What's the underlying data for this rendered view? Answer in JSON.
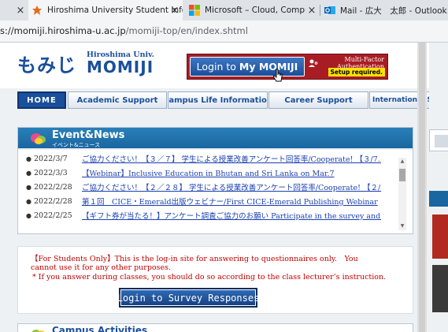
{
  "browser": {
    "tabs": [
      {
        "title": "Hiroshima University Student Infor",
        "close": "×",
        "active": true
      },
      {
        "title": "Microsoft – Cloud, Computers, Ap",
        "close": "×",
        "active": false
      },
      {
        "title": "Mail - 広大　太郎 - Outlook",
        "close": "×",
        "active": false
      }
    ],
    "url_domain": "s://momiji.hiroshima-u.ac.jp",
    "url_path": "/momiji-top/en/index.shtml"
  },
  "header": {
    "logo_jp": "もみじ",
    "logo_univ": "Hiroshima Univ.",
    "logo_name": "MOMIJI",
    "login_prefix": "Login to",
    "login_bold": "My MOMIJI",
    "mfa_line1": "Multi-Factor",
    "mfa_line2": "Authentication",
    "setup": "Setup required."
  },
  "nav": {
    "items": [
      "HOME",
      "Academic Support",
      "Campus Life Information",
      "Career Support",
      "International Student Su"
    ]
  },
  "events": {
    "title": "Event&News",
    "subtitle": "イベント&ニュース",
    "items": [
      {
        "date": "2022/3/7",
        "text": "ご協力ください！【３／７】 学生による授業改善アンケート回答率/Cooperate! 【３/7..."
      },
      {
        "date": "2022/3/3",
        "text": "【Webinar】Inclusive Education in Bhutan and Sri Lanka on Mar.7"
      },
      {
        "date": "2022/2/28",
        "text": "ご協力ください！【２／２８】 学生による授業改善アンケート回答率/Cooperate! 【２/..."
      },
      {
        "date": "2022/2/28",
        "text": "第１回　CICE・Emerald出版ウェビナー/First CICE-Emerald Publishing Webinar"
      },
      {
        "date": "2022/2/25",
        "text": "【ギフト券が当たる！】アンケート調査ご協力のお願い Participate in the survey and..."
      }
    ]
  },
  "notice": {
    "line1": "【For Students Only】This is the log-in site for answering to questionnaires only.　You cannot use it for any other purposes.",
    "line2": "* If you answer during classes, you should do so according to the class lecturer’s instruction.",
    "button": "Login to Survey Responses"
  },
  "campus": {
    "title": "Campus Activities"
  },
  "colors": {
    "brand_blue": "#1a4f9c",
    "login_red": "#a81d24",
    "notice_red": "#c00000",
    "setup_yellow": "#ffe100"
  }
}
